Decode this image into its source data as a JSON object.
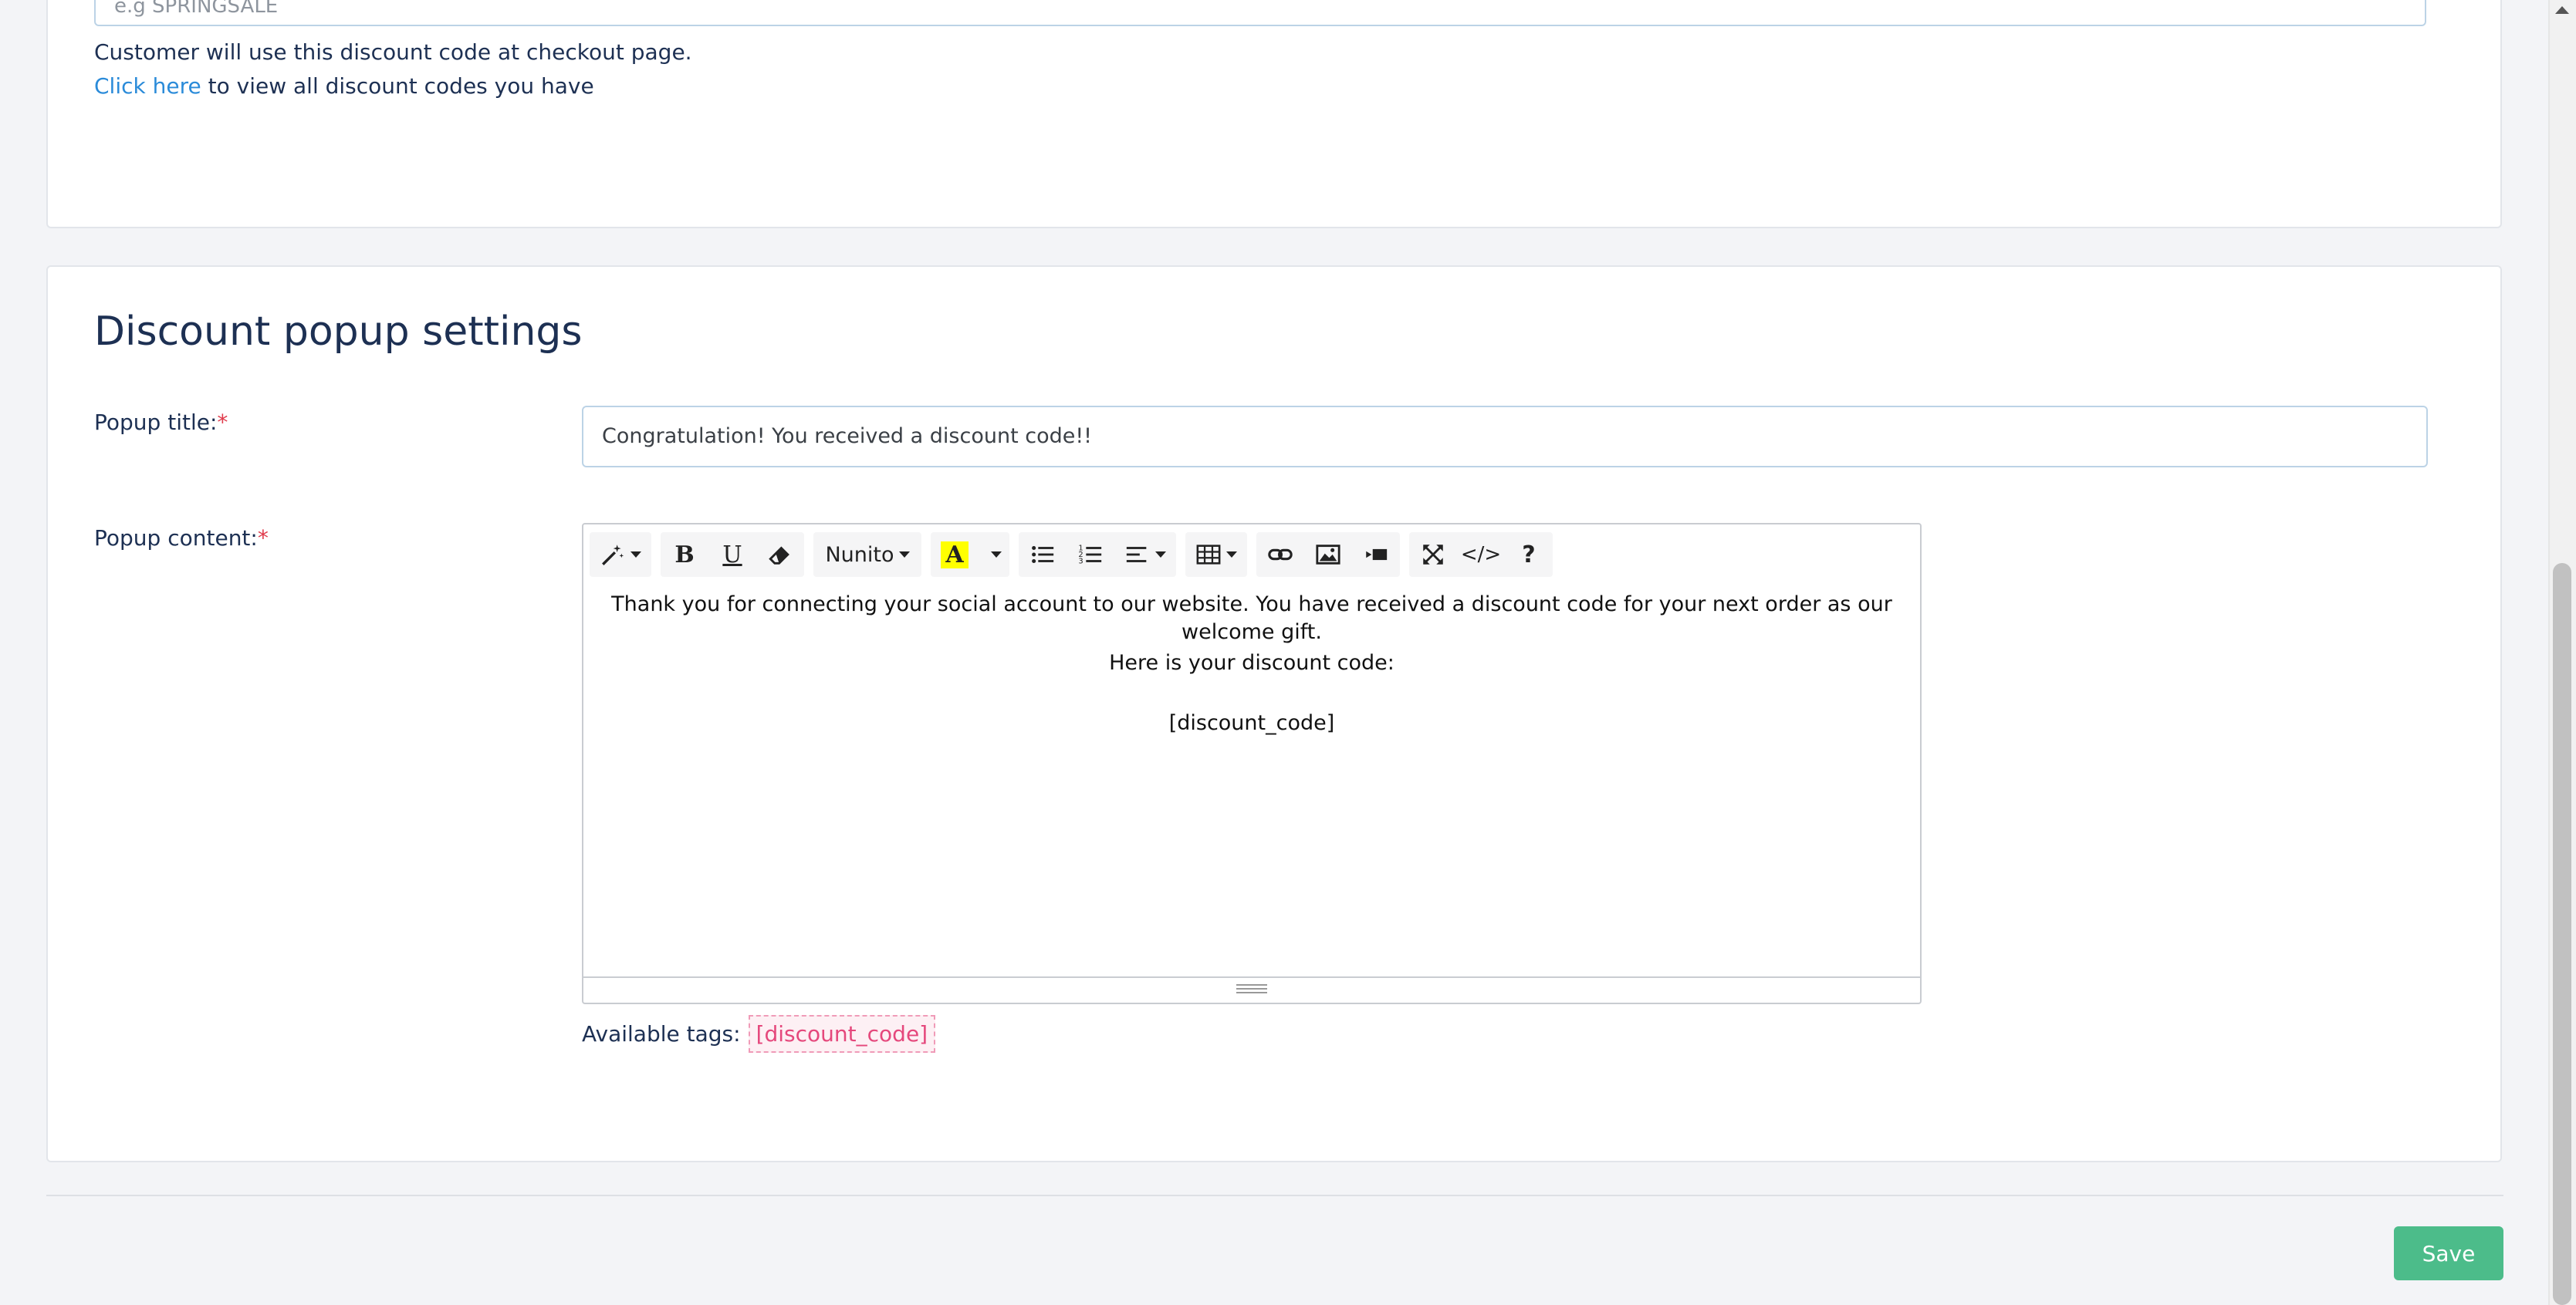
{
  "discount_code": {
    "placeholder": "e.g SPRINGSALE",
    "help_text": "Customer will use this discount code at checkout page.",
    "link_text": "Click here",
    "link_suffix": " to view all discount codes you have"
  },
  "popup_settings": {
    "section_title": "Discount popup settings",
    "title_label": "Popup title:",
    "title_value": "Congratulation! You received a discount code!!",
    "content_label": "Popup content:",
    "required_mark": "*",
    "toolbar": {
      "font_name": "Nunito",
      "icons": [
        "magic-wand-icon",
        "bold-icon",
        "underline-icon",
        "eraser-icon",
        "font-name-dropdown",
        "text-color-icon",
        "unordered-list-icon",
        "ordered-list-icon",
        "align-icon",
        "table-icon",
        "link-icon",
        "image-icon",
        "video-icon",
        "fullscreen-icon",
        "code-view-icon",
        "help-icon"
      ]
    },
    "content_lines": [
      "Thank you for connecting your social account to our website. You have received a discount code for your next order as our welcome gift.",
      "Here is your discount code:",
      "[discount_code]"
    ],
    "available_tags_label": "Available tags:",
    "tags": [
      "[discount_code]"
    ]
  },
  "footer": {
    "save_label": "Save"
  },
  "colors": {
    "accent_link": "#2b8bd9",
    "save_button": "#4cbc8a",
    "required": "#e03a4b",
    "tag": "#e5487c"
  }
}
